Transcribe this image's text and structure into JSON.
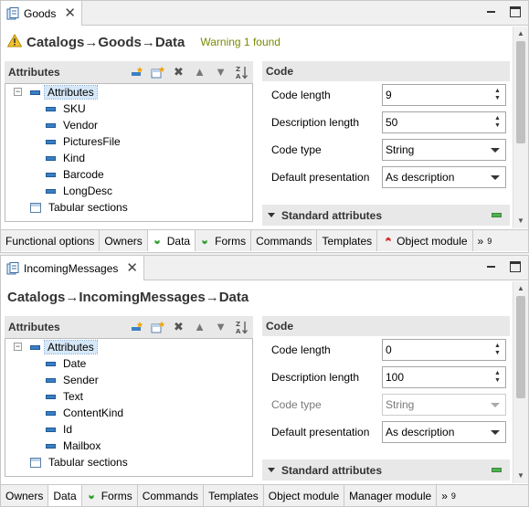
{
  "editors": [
    {
      "tab_title": "Goods",
      "page_title": "Catalogs→Goods→Data",
      "warning": "Warning 1 found",
      "attributes_header": "Attributes",
      "tree": {
        "root": "Attributes",
        "items": [
          "SKU",
          "Vendor",
          "PicturesFile",
          "Kind",
          "Barcode",
          "LongDesc"
        ],
        "tabular": "Tabular sections"
      },
      "code_header": "Code",
      "fields": [
        {
          "label": "Code length",
          "value": "9",
          "kind": "spin",
          "disabled": false
        },
        {
          "label": "Description length",
          "value": "50",
          "kind": "spin",
          "disabled": false
        },
        {
          "label": "Code type",
          "value": "String",
          "kind": "combo",
          "disabled": false
        },
        {
          "label": "Default presentation",
          "value": "As description",
          "kind": "combo",
          "disabled": false
        }
      ],
      "standard_attributes": "Standard attributes",
      "bottom_tabs": [
        {
          "label": "Functional options",
          "icon": "",
          "active": false
        },
        {
          "label": "Owners",
          "icon": "",
          "active": false
        },
        {
          "label": "Data",
          "icon": "green-chevron-icon",
          "active": true
        },
        {
          "label": "Forms",
          "icon": "green-chevron-icon",
          "active": false
        },
        {
          "label": "Commands",
          "icon": "",
          "active": false
        },
        {
          "label": "Templates",
          "icon": "",
          "active": false
        },
        {
          "label": "Object module",
          "icon": "red-chevron-icon",
          "active": false
        }
      ],
      "more_tabs": "»",
      "more_count": "9"
    },
    {
      "tab_title": "IncomingMessages",
      "page_title": "Catalogs→IncomingMessages→Data",
      "warning": "",
      "attributes_header": "Attributes",
      "tree": {
        "root": "Attributes",
        "items": [
          "Date",
          "Sender",
          "Text",
          "ContentKind",
          "Id",
          "Mailbox"
        ],
        "tabular": "Tabular sections"
      },
      "code_header": "Code",
      "fields": [
        {
          "label": "Code length",
          "value": "0",
          "kind": "spin",
          "disabled": false
        },
        {
          "label": "Description length",
          "value": "100",
          "kind": "spin",
          "disabled": false
        },
        {
          "label": "Code type",
          "value": "String",
          "kind": "combo",
          "disabled": true
        },
        {
          "label": "Default presentation",
          "value": "As description",
          "kind": "combo",
          "disabled": false
        }
      ],
      "standard_attributes": "Standard attributes",
      "bottom_tabs": [
        {
          "label": "Owners",
          "icon": "",
          "active": false
        },
        {
          "label": "Data",
          "icon": "",
          "active": true
        },
        {
          "label": "Forms",
          "icon": "green-chevron-icon",
          "active": false
        },
        {
          "label": "Commands",
          "icon": "",
          "active": false
        },
        {
          "label": "Templates",
          "icon": "",
          "active": false
        },
        {
          "label": "Object module",
          "icon": "",
          "active": false
        },
        {
          "label": "Manager module",
          "icon": "",
          "active": false
        }
      ],
      "more_tabs": "»",
      "more_count": "9"
    }
  ],
  "colors": {
    "warning_text": "#7a8a00",
    "selection": "#d6e8f8",
    "attribute_icon": "#3a7fc4",
    "chevron_green": "#2e9d2e",
    "chevron_red": "#d42a2a"
  }
}
